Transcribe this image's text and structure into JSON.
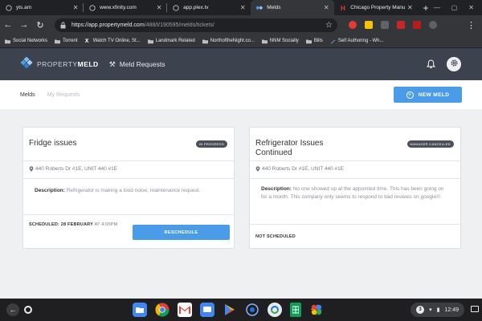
{
  "browser": {
    "tabs": [
      {
        "title": "yts.am",
        "active": false
      },
      {
        "title": "www.xfinity.com",
        "active": false
      },
      {
        "title": "app.plex.tv",
        "active": false
      },
      {
        "title": "Melds",
        "active": true
      },
      {
        "title": "Chicago Property Manu...",
        "active": false
      }
    ],
    "new_tab_label": "+",
    "url_host": "https://app.propertymeld.com",
    "url_path": "/488/t/190595/melds/tickets/",
    "bookmarks": [
      {
        "label": "Social Networks",
        "icon": "folder-icon"
      },
      {
        "label": "Torrent",
        "icon": "folder-icon"
      },
      {
        "label": "Watch TV Online, St...",
        "icon": "x-favicon"
      },
      {
        "label": "Landmark Related",
        "icon": "folder-icon"
      },
      {
        "label": "NorthoftheNight.co...",
        "icon": "folder-icon"
      },
      {
        "label": "NNM Socially",
        "icon": "folder-icon"
      },
      {
        "label": "Bills",
        "icon": "folder-icon"
      },
      {
        "label": "Self Authoring - Wh...",
        "icon": "pen-favicon"
      }
    ]
  },
  "app": {
    "logo_part1": "PROPERTY",
    "logo_part2": "MELD",
    "nav_label": "Meld Requests",
    "subtabs": {
      "melds": "Melds",
      "my_requests": "My Requests"
    },
    "new_meld_label": "NEW MELD"
  },
  "cards": [
    {
      "title": "Fridge issues",
      "badge": "IN PROGRESS",
      "address": "440 Roberts Dr #1E, UNIT 440 #1E",
      "description_label": "Description:",
      "description": "Refrigerator is making a loud noise, maintenance request.",
      "scheduled_label": "SCHEDULED: 28 FEBRUARY",
      "scheduled_time": "AT 4:00PM",
      "button_label": "RESCHEDULE"
    },
    {
      "title_line1": "Refrigerator Issues",
      "title_line2": "Continued",
      "badge": "MANAGER CANCELLED",
      "address": "440 Roberts Dr #1E, UNIT 440 #1E",
      "description_label": "Description:",
      "description": "No one showed up at the appointed time. This has been going on for a month. This company only seems to respond to bad reviews on google!!!",
      "scheduled_label": "NOT SCHEDULED"
    }
  ],
  "shelf": {
    "tray_badge": "3",
    "time": "12:49"
  },
  "colors": {
    "header_bg": "#3d434e",
    "accent_blue": "#4a9ce8",
    "content_bg": "#eef0f2",
    "badge_bg": "#4b5058"
  }
}
